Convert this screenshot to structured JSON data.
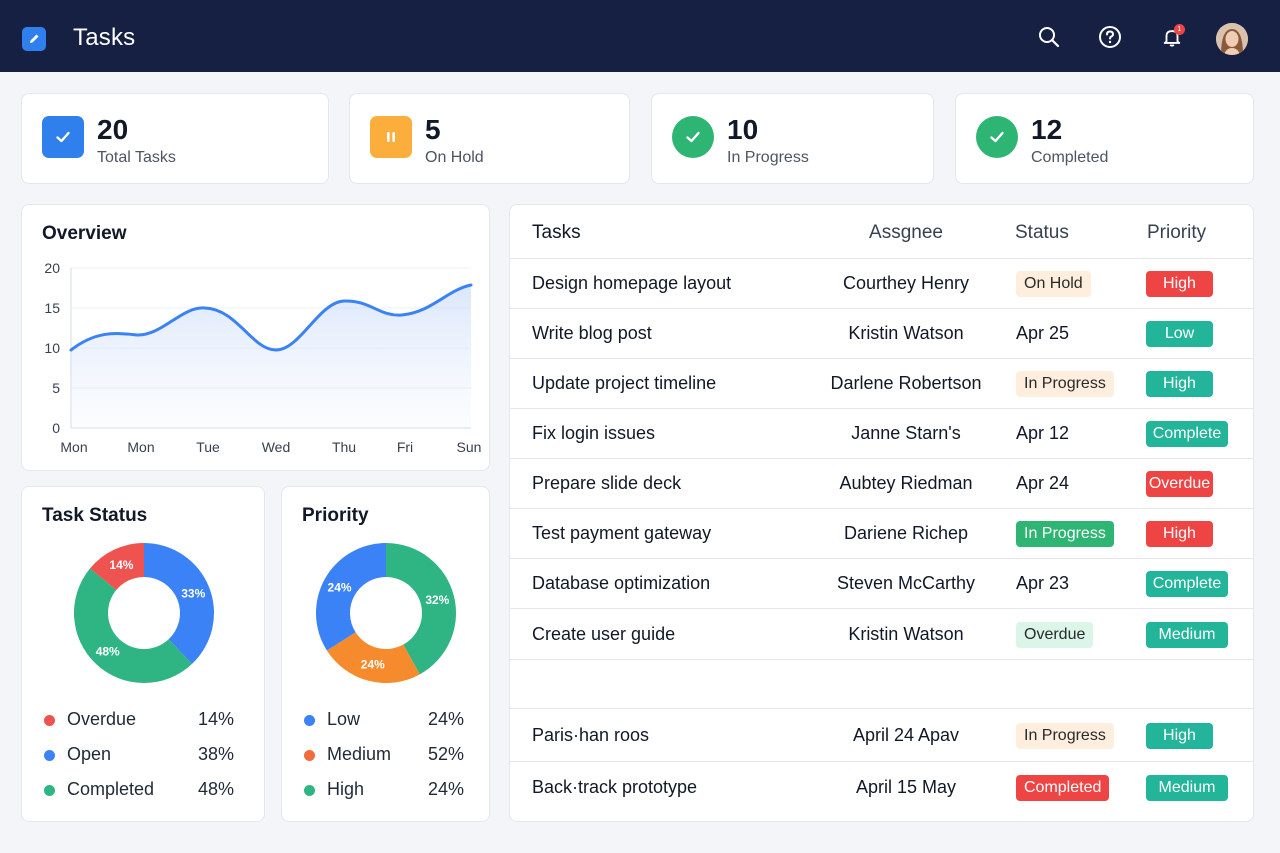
{
  "app": {
    "title": "Tasks",
    "notification_count": "1"
  },
  "colors": {
    "header": "#162042",
    "blue": "#2f80ed",
    "orange": "#fbae3c",
    "green": "#2fb573",
    "red": "#ef4444",
    "teal": "#23b59a"
  },
  "stats": [
    {
      "value": "20",
      "label": "Total Tasks",
      "icon": "checkbox-icon",
      "color": "#2f80ed"
    },
    {
      "value": "5",
      "label": "On Hold",
      "icon": "pause-icon",
      "color": "#fbae3c"
    },
    {
      "value": "10",
      "label": "In Progress",
      "icon": "check-circle-icon",
      "color": "#2fb573"
    },
    {
      "value": "12",
      "label": "Completed",
      "icon": "check-circle-icon",
      "color": "#2fb573"
    }
  ],
  "overview": {
    "title": "Overview",
    "y_ticks": [
      "20",
      "15",
      "10",
      "5",
      "0"
    ],
    "x_ticks": [
      "Mon",
      "Mon",
      "Tue",
      "Wed",
      "Thu",
      "Fri",
      "Sun"
    ]
  },
  "task_status": {
    "title": "Task Status",
    "slices": [
      {
        "label": "14%",
        "value": 14,
        "color": "#ef5350"
      },
      {
        "label": "33%",
        "value": 38,
        "color": "#3b82f6"
      },
      {
        "label": "48%",
        "value": 48,
        "color": "#2fb583"
      }
    ],
    "legend": [
      {
        "label": "Overdue",
        "pct": "14%",
        "color": "#ef5350"
      },
      {
        "label": "Open",
        "pct": "38%",
        "color": "#3b82f6"
      },
      {
        "label": "Completed",
        "pct": "48%",
        "color": "#2fb583"
      }
    ]
  },
  "priority": {
    "title": "Priority",
    "slices": [
      {
        "label": "32%",
        "value": 42,
        "color": "#2fb583"
      },
      {
        "label": "24%",
        "value": 24,
        "color": "#f58b2c"
      },
      {
        "label": "24%",
        "value": 34,
        "color": "#3b82f6"
      }
    ],
    "legend": [
      {
        "label": "Low",
        "pct": "24%",
        "color": "#3b82f6"
      },
      {
        "label": "Medium",
        "pct": "52%",
        "color": "#f26b3a"
      },
      {
        "label": "High",
        "pct": "24%",
        "color": "#2fb583"
      }
    ]
  },
  "tasks": {
    "headers": {
      "task": "Tasks",
      "assignee": "Assgnee",
      "status": "Status",
      "priority": "Priority"
    },
    "rows": [
      {
        "task": "Design homepage layout",
        "assignee": "Courthey Henry",
        "status": "On Hold",
        "status_style": "pill-orange-light",
        "priority": "High",
        "priority_color": "#ef4444",
        "wide": false
      },
      {
        "task": "Write blog post",
        "assignee": "Kristin Watson",
        "status": "Apr 25",
        "status_style": "text",
        "priority": "Low",
        "priority_color": "#23b59a",
        "wide": false
      },
      {
        "task": "Update project timeline",
        "assignee": "Darlene Robertson",
        "status": "In Progress",
        "status_style": "pill-orange-light",
        "priority": "High",
        "priority_color": "#23b59a",
        "wide": false
      },
      {
        "task": "Fix login issues",
        "assignee": "Janne Starn's",
        "status": "Apr 12",
        "status_style": "text",
        "priority": "Complete",
        "priority_color": "#23b59a",
        "wide": true
      },
      {
        "task": "Prepare slide deck",
        "assignee": "Aubtey Riedman",
        "status": "Apr 24",
        "status_style": "text",
        "priority": "Overdue",
        "priority_color": "#ef4444",
        "wide": false
      },
      {
        "task": "Test payment gateway",
        "assignee": "Dariene Richep",
        "status": "In Progress",
        "status_style": "pill-green",
        "priority": "High",
        "priority_color": "#ef4444",
        "wide": false
      },
      {
        "task": "Database optimization",
        "assignee": "Steven McCarthy",
        "status": "Apr 23",
        "status_style": "text",
        "priority": "Complete",
        "priority_color": "#23b59a",
        "wide": true
      },
      {
        "task": "Create user guide",
        "assignee": "Kristin Watson",
        "status": "Overdue",
        "status_style": "pill-green-light",
        "priority": "Medium",
        "priority_color": "#23b59a",
        "wide": true
      },
      {
        "task": "",
        "assignee": "",
        "status": "",
        "status_style": "empty",
        "priority": "",
        "priority_color": "",
        "wide": false
      },
      {
        "task": "Paris·han roos",
        "assignee": "April 24  Apav",
        "status": "In Progress",
        "status_style": "pill-orange-light",
        "priority": "High",
        "priority_color": "#23b59a",
        "wide": false
      },
      {
        "task": "Back·track prototype",
        "assignee": "April 15  May",
        "status": "Completed",
        "status_style": "pill-red",
        "priority": "Medium",
        "priority_color": "#23b59a",
        "wide": true
      }
    ]
  }
}
